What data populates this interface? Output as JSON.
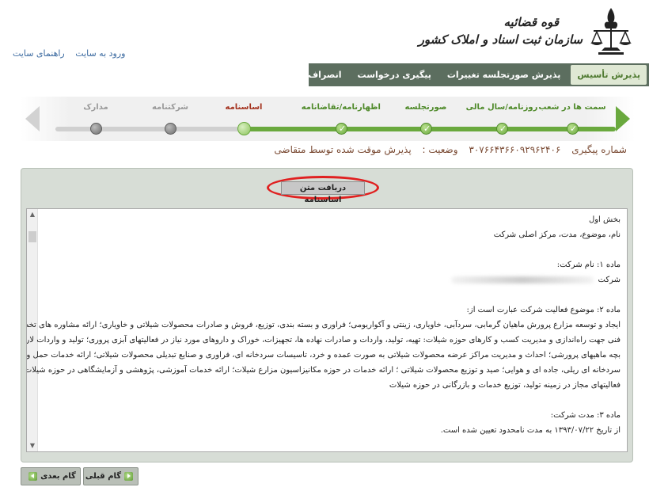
{
  "header": {
    "links": [
      "ورود به سایت",
      "راهنمای سایت"
    ],
    "logo_line1": "قوه قضائیه",
    "logo_line2": "سازمان ثبت اسناد و املاک کشور"
  },
  "nav": {
    "items": [
      {
        "label": "پذیرش تأسیس",
        "active": true
      },
      {
        "label": "پذیرش صورتجلسه تغییرات",
        "active": false
      },
      {
        "label": "پیگیری درخواست",
        "active": false
      },
      {
        "label": "انصراف از درخواست",
        "active": false
      }
    ]
  },
  "stepper": {
    "steps": [
      {
        "label": "سمت ها در شعب",
        "state": "done"
      },
      {
        "label": "روزنامه/سال مالی",
        "state": "done"
      },
      {
        "label": "صورتجلسه",
        "state": "done"
      },
      {
        "label": "اظهارنامه/تقاضانامه",
        "state": "done"
      },
      {
        "label": "اساسنامه",
        "state": "current"
      },
      {
        "label": "شرکتنامه",
        "state": "todo"
      },
      {
        "label": "مدارک",
        "state": "todo"
      }
    ]
  },
  "status": {
    "tracking_label": "شماره پیگیری",
    "tracking_number": "۳۰۷۶۶۴۳۶۶۰۹۲۹۶۲۴۰۶",
    "state_label": "وضعیت :",
    "state_value": "پذیرش موقت شده توسط متقاضی"
  },
  "panel": {
    "download_button": "دریافت متن اساسنامه",
    "content_lines": [
      "بخش اول",
      "نام، موضوع، مدت، مرکز اصلی شرکت",
      "ماده ۱: نام شرکت:",
      "شرکت",
      "ماده ۲: موضوع فعالیت شرکت عبارت است از:",
      "ایجاد و توسعه مزارع پرورش ماهیان گرمابی، سردآبی، خاویاری، زینتی و آکواریومی؛ فراوری و بسته بندی، توزیع، فروش و صادرات محصولات شیلاتی و خاویاری؛ ارائه مشاوره های تخصصی و",
      "فنی جهت راه‌اندازی و مدیریت کسب و کارهای حوزه شیلات: تهیه، تولید، واردات و صادرات نهاده ها، تجهیزات، خوراک و داروهای مورد نیاز در فعالیتهای آبزی پروری؛ تولید و واردات لارو و",
      "بچه ماهیهای پرورشی؛ احداث و مدیریت مراکز عرضه محصولات شیلاتی به صورت عمده و خرد، تاسیسات سردخانه ای،  فراوری و صنایع تبدیلی محصولات شیلاتی؛ ارائه خدمات حمل و نقل",
      "سردخانه ای ریلی، جاده ای و هوایی؛ صید و توزیع محصولات شیلاتی ؛ ارائه خدمات در حوزه مکانیزاسیون مزارع شیلات؛ ارائه خدمات آموزشی،  پژوهشی و آزمایشگاهی در حوزه شیلات؛ سایر",
      "فعالیتهای مجاز در زمینه تولید، توزیع خدمات و بازرگانی در حوزه شیلات",
      "ماده ۳: مدت شرکت:",
      "از تاریخ ۱۳۹۳/۰۷/۲۲ به مدت نامحدود تعیین شده است."
    ]
  },
  "footer": {
    "prev_label": "گام قبلی",
    "next_label": "گام بعدی"
  },
  "colors": {
    "nav_bg": "#5c6e5f",
    "accent_green": "#6aa93e",
    "current_step": "#a4321e",
    "highlight_red": "#e02020",
    "panel_bg": "#d7ddd6"
  }
}
